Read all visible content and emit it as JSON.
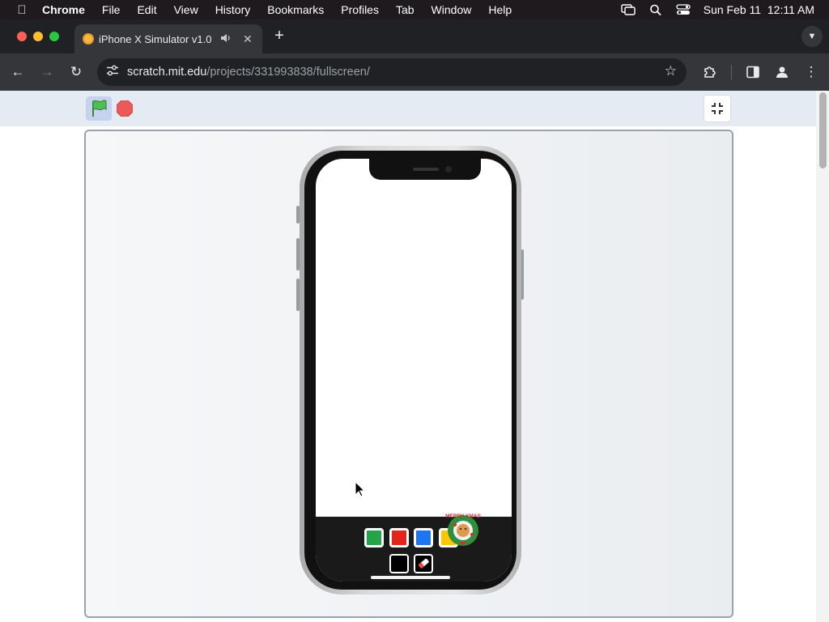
{
  "menubar": {
    "app_name": "Chrome",
    "items": [
      "File",
      "Edit",
      "View",
      "History",
      "Bookmarks",
      "Profiles",
      "Tab",
      "Window",
      "Help"
    ],
    "clock": "Sun Feb 11  12:11 AM"
  },
  "browser": {
    "tab_title": "iPhone X Simulator v1.0",
    "url_host": "scratch.mit.edu",
    "url_path": "/projects/331993838/fullscreen/"
  },
  "scratch": {
    "palette": [
      "#22a447",
      "#e3251e",
      "#1f74f0",
      "#ffc500"
    ],
    "sprite_text": "MERRY XMAS"
  }
}
